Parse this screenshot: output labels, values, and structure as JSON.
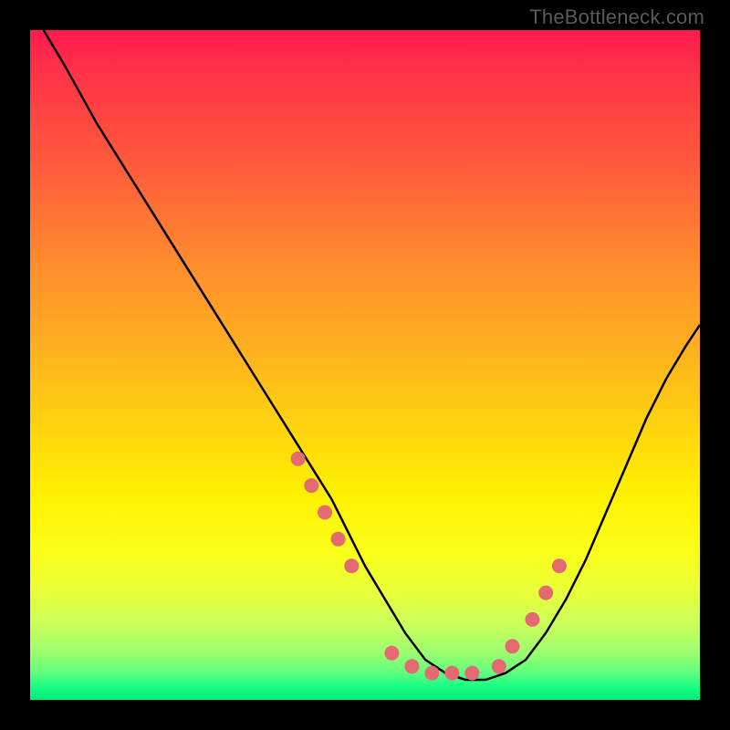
{
  "attribution": "TheBottleneck.com",
  "colors": {
    "frame": "#000000",
    "curve": "#000000",
    "dots": "#e46a72"
  },
  "chart_data": {
    "type": "line",
    "title": "",
    "xlabel": "",
    "ylabel": "",
    "xlim": [
      0,
      100
    ],
    "ylim": [
      0,
      100
    ],
    "series": [
      {
        "name": "bottleneck-curve",
        "x": [
          2,
          5,
          10,
          15,
          20,
          25,
          30,
          35,
          40,
          45,
          48,
          50,
          53,
          56,
          59,
          62,
          65,
          68,
          71,
          74,
          77,
          80,
          83,
          86,
          89,
          92,
          95,
          98,
          100
        ],
        "values": [
          100,
          95,
          86,
          78,
          70,
          62,
          54,
          46,
          38,
          30,
          24,
          20,
          15,
          10,
          6,
          4,
          3,
          3,
          4,
          6,
          10,
          15,
          21,
          28,
          35,
          42,
          48,
          53,
          56
        ]
      }
    ],
    "markers": {
      "name": "highlight-dots",
      "x": [
        40,
        42,
        44,
        46,
        48,
        54,
        57,
        60,
        63,
        66,
        70,
        72,
        75,
        77,
        79
      ],
      "values": [
        36,
        32,
        28,
        24,
        20,
        7,
        5,
        4,
        4,
        4,
        5,
        8,
        12,
        16,
        20
      ]
    }
  }
}
